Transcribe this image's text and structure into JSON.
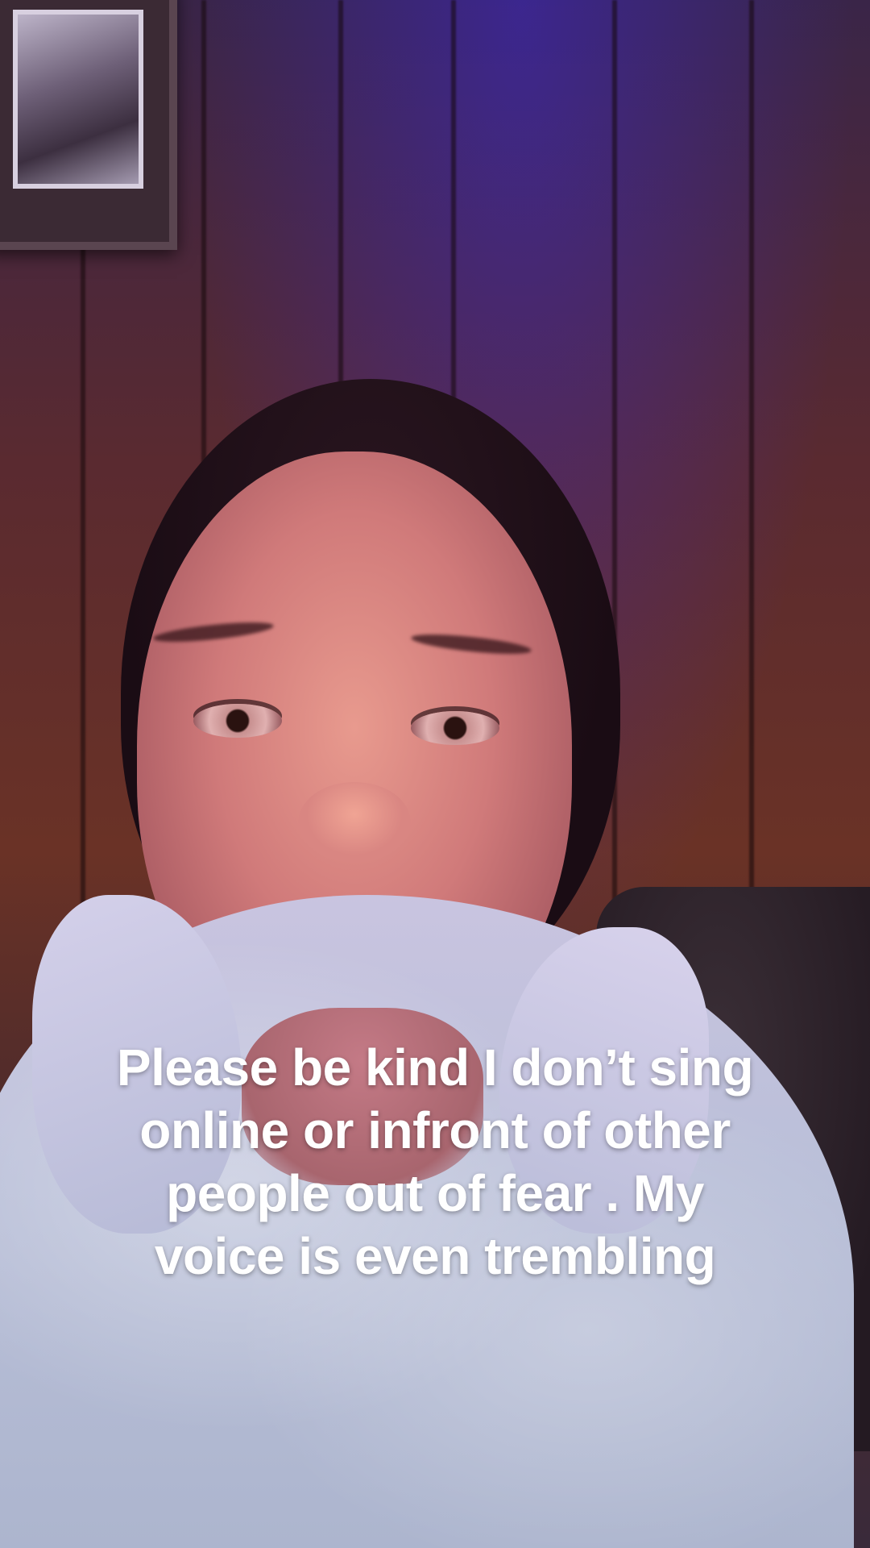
{
  "caption": {
    "line1": "Please be kind I don’t sing",
    "line2": "online or infront of other",
    "line3": "people out of fear . My",
    "line4": "voice is even trembling"
  },
  "colors": {
    "caption_text": "#ffffff",
    "purple_light": "#3c28c8",
    "wood_wall": "#6a3226",
    "hoodie": "#b9bfd8"
  }
}
